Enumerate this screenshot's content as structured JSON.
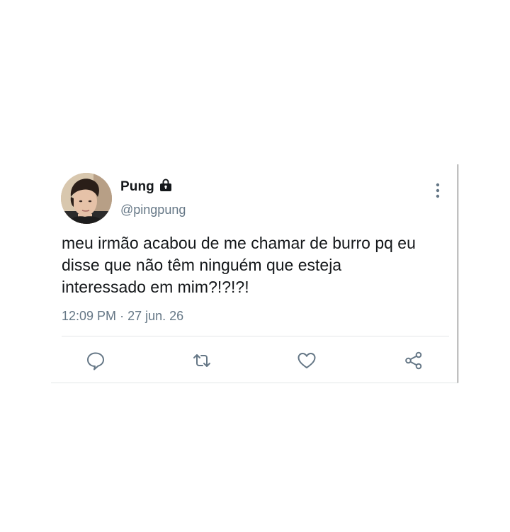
{
  "tweet": {
    "display_name": "Pung",
    "handle": "@pingpung",
    "text": "meu irmão acabou de me chamar de burro pq eu\ndisse que não têm ninguém que esteja\ninteressado em mim?!?!?!",
    "time": "12:09 PM",
    "separator": "·",
    "date": "27 jun. 26",
    "protected_icon": "lock-icon"
  },
  "actions": {
    "reply_icon": "reply-icon",
    "retweet_icon": "retweet-icon",
    "like_icon": "heart-icon",
    "share_icon": "share-icon",
    "more_icon": "more-vertical-icon"
  },
  "colors": {
    "text_primary": "#14171a",
    "text_secondary": "#657786",
    "icon_gray": "#657786",
    "divider": "#e3e6e8"
  }
}
